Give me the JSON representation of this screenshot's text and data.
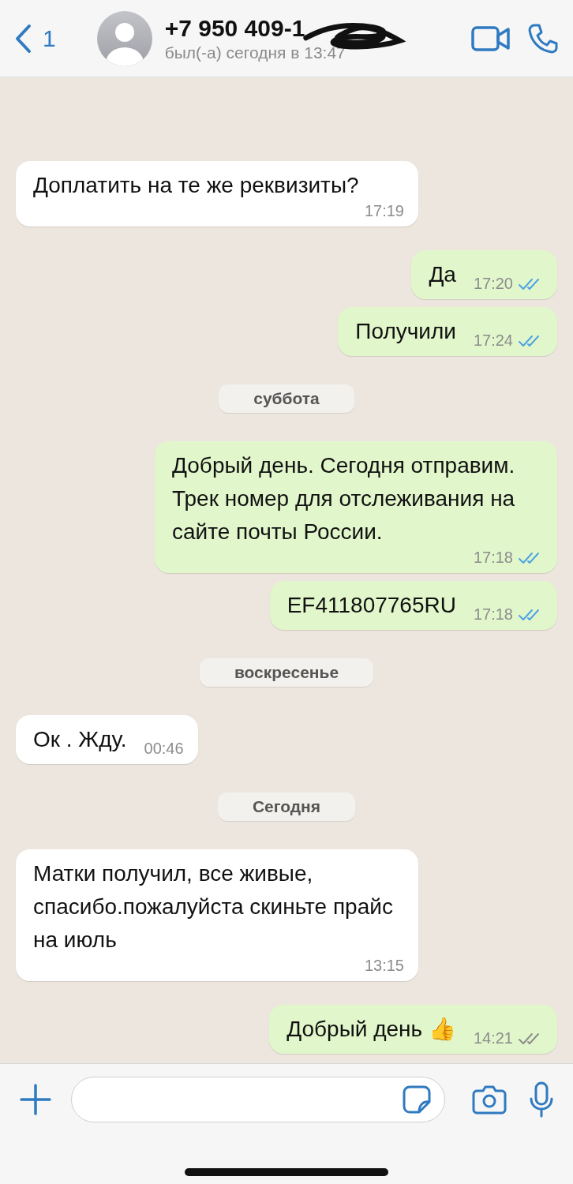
{
  "header": {
    "back_count": "1",
    "name": "+7 950 409-1",
    "status": "был(-а) сегодня в 13:47"
  },
  "messages": [
    {
      "kind": "in",
      "text": "Доплатить на те же реквизиты?",
      "time": "17:19"
    },
    {
      "kind": "out",
      "text": "Да",
      "time": "17:20",
      "read": true
    },
    {
      "kind": "out",
      "text": "Получили",
      "time": "17:24",
      "read": true
    },
    {
      "kind": "date",
      "text": "суббота"
    },
    {
      "kind": "out",
      "text": "Добрый день. Сегодня отправим. Трек номер для отслеживания на сайте почты России.",
      "time": "17:18",
      "read": true
    },
    {
      "kind": "out",
      "text": "EF411807765RU",
      "time": "17:18",
      "read": true
    },
    {
      "kind": "date",
      "text": "воскресенье"
    },
    {
      "kind": "in",
      "text": "Ок . Жду.",
      "time": "00:46"
    },
    {
      "kind": "date",
      "text": "Сегодня"
    },
    {
      "kind": "in",
      "text": "Матки получил, все живые, спасибо.пожалуйста скиньте прайс на июль",
      "time": "13:15"
    },
    {
      "kind": "out",
      "text": "Добрый день 👍",
      "time": "14:21",
      "read": false
    }
  ]
}
